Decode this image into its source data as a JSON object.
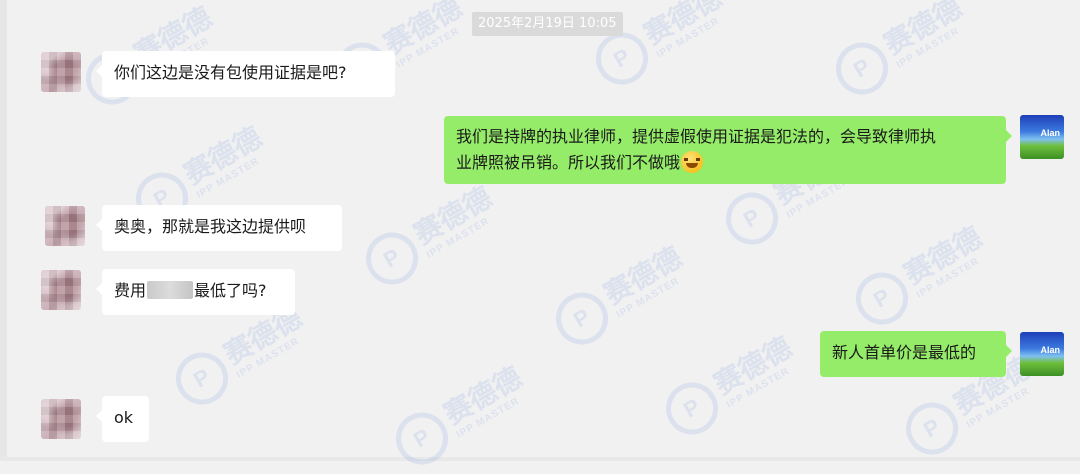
{
  "timestamp": "2025年2月19日 10:05",
  "watermark": {
    "logo_letter": "P",
    "text": "赛德德",
    "subtext": "IPP MASTER"
  },
  "messages": [
    {
      "side": "left",
      "text": "你们这边是没有包使用证据是吧?"
    },
    {
      "side": "right",
      "lines": [
        "我们是持牌的执业律师，提供虚假使用证据是犯法的，会导致律师执",
        "业牌照被吊销。所以我们不做哦"
      ],
      "emoji": "rofl-emoji"
    },
    {
      "side": "left",
      "text": "奥奥，那就是我这边提供呗"
    },
    {
      "side": "left",
      "text_before": "费用",
      "text_after": "最低了吗?"
    },
    {
      "side": "right",
      "text": "新人首单价是最低的"
    },
    {
      "side": "left",
      "text": "ok"
    }
  ],
  "self_avatar": {
    "label": "Alan"
  },
  "colors": {
    "background": "#f1f1f1",
    "bubble_self": "#95ec69",
    "bubble_other": "#ffffff",
    "timestamp_bg": "#dadada"
  }
}
